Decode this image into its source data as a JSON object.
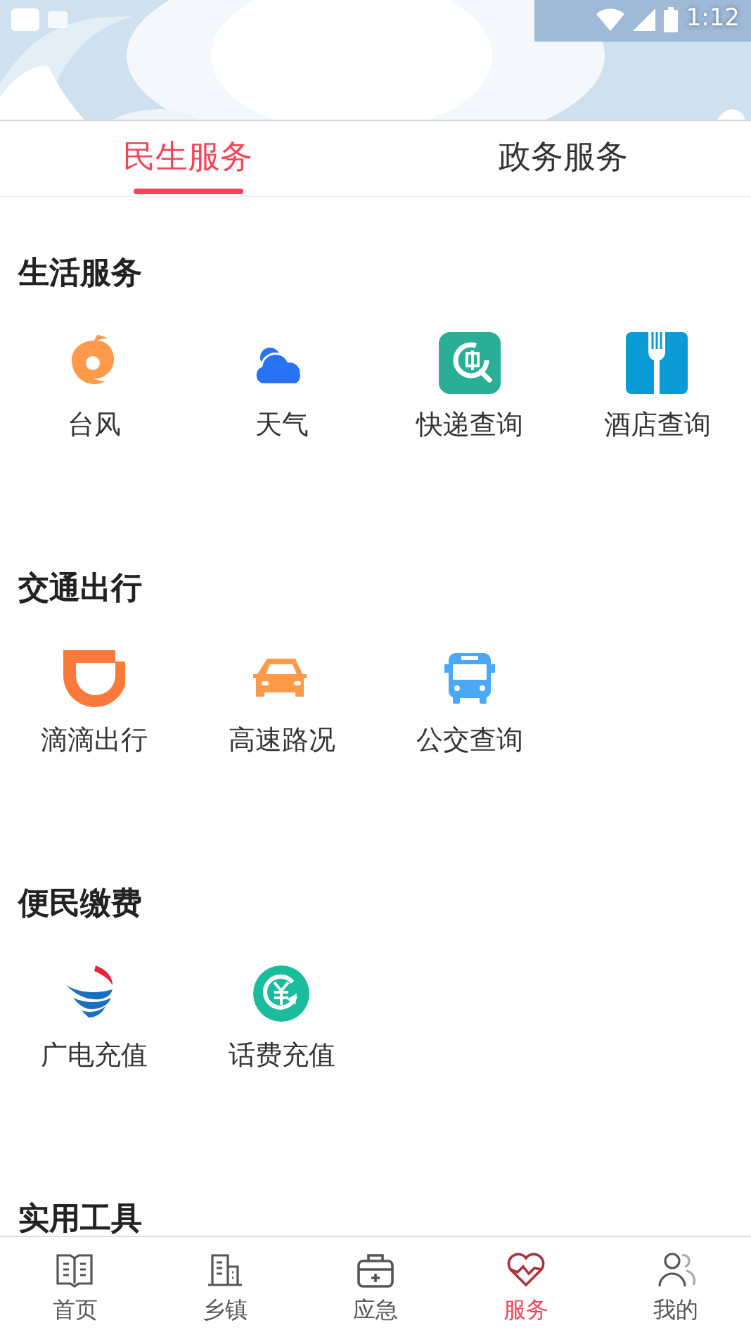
{
  "status_bar": {
    "time": "1:12"
  },
  "tabs": [
    {
      "label": "民生服务",
      "selected": true
    },
    {
      "label": "政务服务",
      "selected": false
    }
  ],
  "sections": [
    {
      "title": "生活服务",
      "items": [
        {
          "label": "台风",
          "kind": "typhoon"
        },
        {
          "label": "天气",
          "kind": "cloud"
        },
        {
          "label": "快递查询",
          "kind": "express"
        },
        {
          "label": "酒店查询",
          "kind": "hotel"
        }
      ]
    },
    {
      "title": "交通出行",
      "items": [
        {
          "label": "滴滴出行",
          "kind": "didi"
        },
        {
          "label": "高速路况",
          "kind": "car"
        },
        {
          "label": "公交查询",
          "kind": "bus"
        }
      ]
    },
    {
      "title": "便民缴费",
      "items": [
        {
          "label": "广电充值",
          "kind": "wings"
        },
        {
          "label": "话费充值",
          "kind": "recharge"
        }
      ]
    },
    {
      "title": "实用工具"
    }
  ],
  "bottom_nav": [
    {
      "label": "首页",
      "kind": "book",
      "selected": false
    },
    {
      "label": "乡镇",
      "kind": "buildings",
      "selected": false
    },
    {
      "label": "应急",
      "kind": "kit",
      "selected": false
    },
    {
      "label": "服务",
      "kind": "heart",
      "selected": true
    },
    {
      "label": "我的",
      "kind": "people",
      "selected": false
    }
  ]
}
